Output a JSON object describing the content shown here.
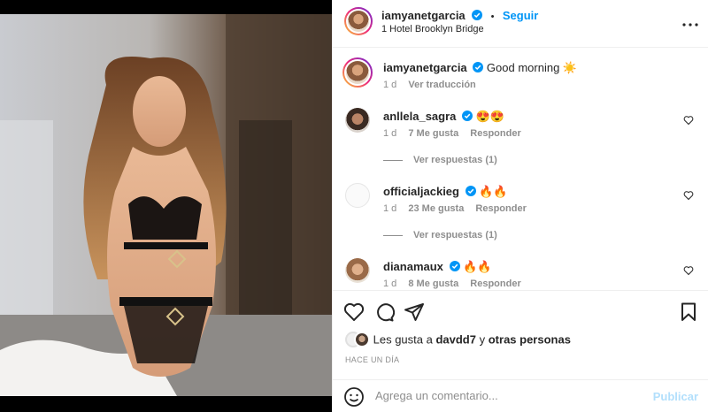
{
  "post": {
    "username": "iamyanetgarcia",
    "follow_label": "Seguir",
    "separator": "•",
    "location": "1 Hotel Brooklyn Bridge",
    "more_icon": "more-horizontal-icon"
  },
  "caption": {
    "username": "iamyanetgarcia",
    "text": "Good morning ☀️",
    "time": "1 d",
    "translate_label": "Ver traducción"
  },
  "comments": [
    {
      "username": "anllela_sagra",
      "text": "😍😍",
      "time": "1 d",
      "likes": "7 Me gusta",
      "reply_label": "Responder",
      "view_replies": "Ver respuestas (1)"
    },
    {
      "username": "officialjackieg",
      "text": "🔥🔥",
      "time": "1 d",
      "likes": "23 Me gusta",
      "reply_label": "Responder",
      "view_replies": "Ver respuestas (1)"
    },
    {
      "username": "dianamaux",
      "text": "🔥🔥",
      "time": "1 d",
      "likes": "8 Me gusta",
      "reply_label": "Responder"
    }
  ],
  "likes": {
    "prefix": "Les gusta a",
    "user": "davdd7",
    "connector": "y",
    "others": "otras personas"
  },
  "timeago": "HACE UN DÍA",
  "add_comment": {
    "placeholder": "Agrega un comentario...",
    "publish_label": "Publicar"
  },
  "colors": {
    "accent": "#0095f6",
    "text": "#262626",
    "muted": "#8e8e8e",
    "publish_disabled": "#b2dffc"
  }
}
